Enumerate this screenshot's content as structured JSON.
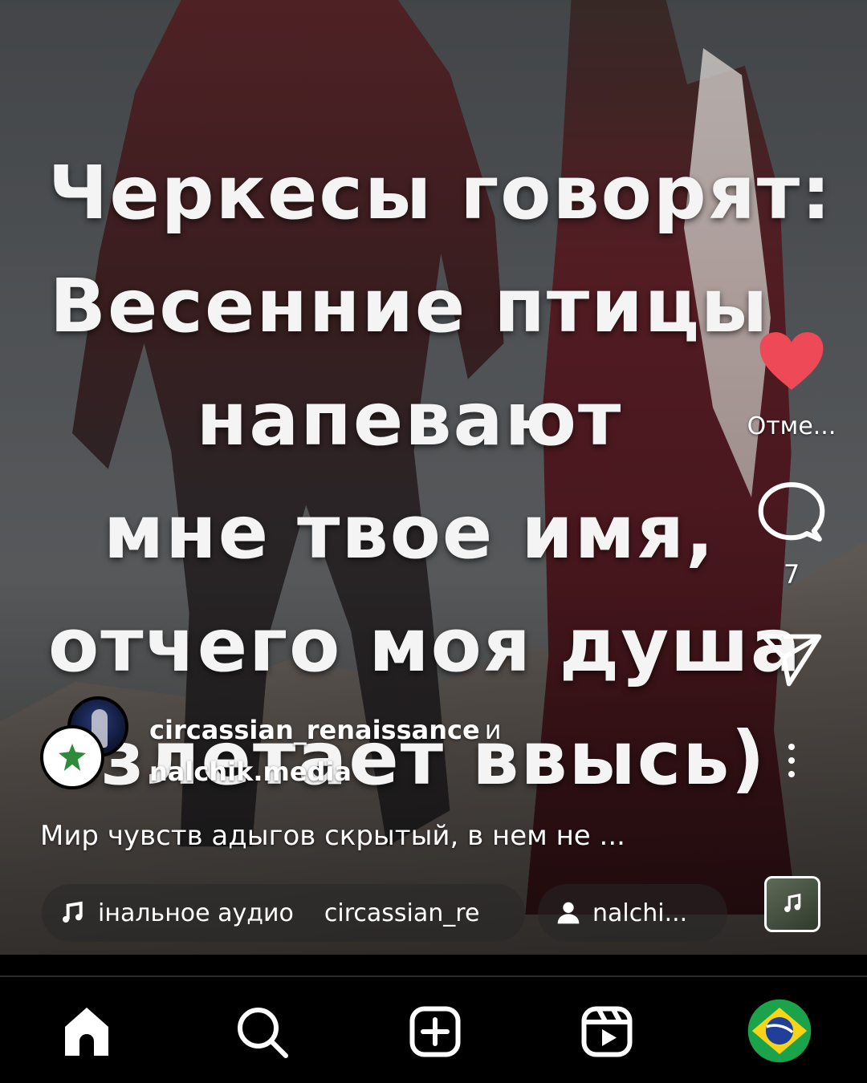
{
  "overlay": {
    "lines": [
      "Черкесы говорят:",
      "Весенние птицы",
      "напевают",
      "мне твое имя,",
      "отчего моя душа",
      "взлетает ввысь)"
    ]
  },
  "actions": {
    "like_label": "Отме...",
    "comment_count": "7",
    "liked_color": "#ed4956"
  },
  "authors": {
    "first": "circassian_renaissance",
    "conjunction": "и",
    "second": "nalchik.media"
  },
  "caption": "Мир чувств адыгов скрытый, в нем не ...",
  "audio_chip": {
    "icon": "music-note-icon",
    "title": "інальное аудио",
    "artist": "circassian_re"
  },
  "user_chip": {
    "icon": "person-icon",
    "label": "nalchi..."
  },
  "nav": {
    "items": [
      "home-icon",
      "search-icon",
      "create-icon",
      "reels-icon",
      "profile-avatar"
    ]
  }
}
